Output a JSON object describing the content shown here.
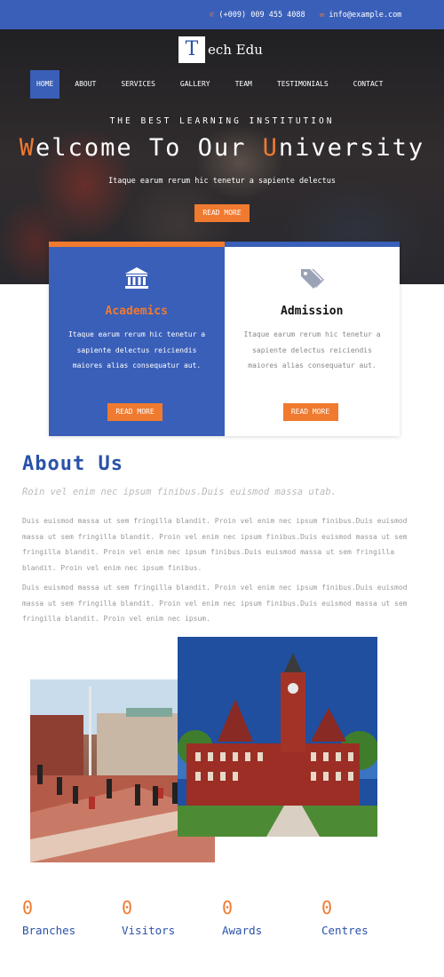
{
  "topbar": {
    "phone_icon": "phone-icon",
    "phone": "(+009) 009 455 4088",
    "email_icon": "envelope-icon",
    "email": "info@example.com"
  },
  "brand": {
    "mark": "T",
    "name": "ech Edu"
  },
  "nav": [
    "HOME",
    "ABOUT",
    "SERVICES",
    "GALLERY",
    "TEAM",
    "TESTIMONIALS",
    "CONTACT"
  ],
  "hero": {
    "kicker": "THE BEST LEARNING INSTITUTION",
    "title_pre": "W",
    "title_mid": "elcome To Our ",
    "title_u": "U",
    "title_post": "niversity",
    "subtitle": "Itaque earum rerum hic tenetur a sapiente delectus",
    "button": "READ MORE"
  },
  "cards": [
    {
      "icon": "building-icon",
      "title": "Academics",
      "text": "Itaque earum rerum hic tenetur a sapiente delectus reiciendis maiores alias consequatur aut.",
      "button": "READ MORE"
    },
    {
      "icon": "tags-icon",
      "title": "Admission",
      "text": "Itaque earum rerum hic tenetur a sapiente delectus reiciendis maiores alias consequatur aut.",
      "button": "READ MORE"
    }
  ],
  "about": {
    "title": "About Us",
    "quote": "Roin vel enim nec ipsum finibus.Duis euismod massa utab.",
    "p1": "Duis euismod massa ut sem fringilla blandit. Proin vel enim nec ipsum finibus.Duis euismod massa ut sem fringilla blandit. Proin vel enim nec ipsum finibus.Duis euismod massa ut sem fringilla blandit. Proin vel enim nec ipsum finibus.Duis euismod massa ut sem fringilla blandit. Proin vel enim nec ipsum finibus.",
    "p2": "Duis euismod massa ut sem fringilla blandit. Proin vel enim nec ipsum finibus.Duis euismod massa ut sem fringilla blandit. Proin vel enim nec ipsum finibus.Duis euismod massa ut sem fringilla blandit. Proin vel enim nec ipsum."
  },
  "stats": [
    {
      "value": "0",
      "label": "Branches"
    },
    {
      "value": "0",
      "label": "Visitors"
    },
    {
      "value": "0",
      "label": "Awards"
    },
    {
      "value": "0",
      "label": "Centres"
    }
  ],
  "colors": {
    "primary": "#3a5fb8",
    "accent": "#f07a2f"
  }
}
